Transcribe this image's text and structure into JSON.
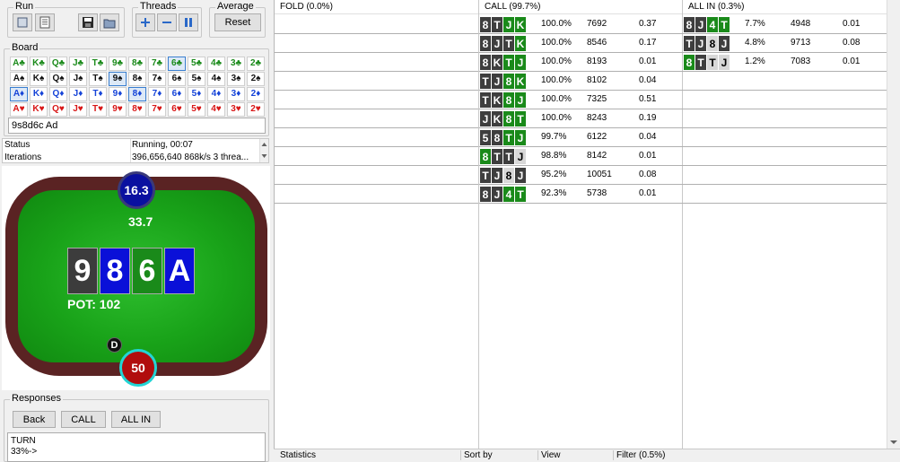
{
  "run": {
    "label": "Run"
  },
  "threads": {
    "label": "Threads"
  },
  "average": {
    "label": "Average",
    "reset_label": "Reset"
  },
  "board_group": {
    "label": "Board",
    "input_value": "9s8d6c Ad"
  },
  "card_grid": [
    {
      "suit": "c",
      "suit_symbol": "♣",
      "cards": [
        "A♣",
        "K♣",
        "Q♣",
        "J♣",
        "T♣",
        "9♣",
        "8♣",
        "7♣",
        "6♣",
        "5♣",
        "4♣",
        "3♣",
        "2♣"
      ],
      "selected_index": 8
    },
    {
      "suit": "s",
      "suit_symbol": "♠",
      "cards": [
        "A♠",
        "K♠",
        "Q♠",
        "J♠",
        "T♠",
        "9♠",
        "8♠",
        "7♠",
        "6♠",
        "5♠",
        "4♠",
        "3♠",
        "2♠"
      ],
      "selected_index": 5
    },
    {
      "suit": "d",
      "suit_symbol": "♦",
      "cards": [
        "A♦",
        "K♦",
        "Q♦",
        "J♦",
        "T♦",
        "9♦",
        "8♦",
        "7♦",
        "6♦",
        "5♦",
        "4♦",
        "3♦",
        "2♦"
      ],
      "selected_index": 6,
      "selected_index_2": 0
    },
    {
      "suit": "h",
      "suit_symbol": "♥",
      "cards": [
        "A♥",
        "K♥",
        "Q♥",
        "J♥",
        "T♥",
        "9♥",
        "8♥",
        "7♥",
        "6♥",
        "5♥",
        "4♥",
        "3♥",
        "2♥"
      ],
      "selected_index": -1
    }
  ],
  "status": {
    "status_label": "Status",
    "status_value": "Running, 00:07",
    "iterations_label": "Iterations",
    "iterations_value": "396,656,640  868k/s 3 threa..."
  },
  "table": {
    "top_stack": "16.3",
    "top_bet": "33.7",
    "bottom_stack": "50",
    "dealer": "D",
    "pot_label": "POT: 102",
    "board_cards": [
      {
        "rank": "9",
        "color": "#3c3c3c"
      },
      {
        "rank": "8",
        "color": "#0a10d8"
      },
      {
        "rank": "6",
        "color": "#1a8a1a"
      },
      {
        "rank": "A",
        "color": "#0a10d8"
      }
    ]
  },
  "responses": {
    "label": "Responses",
    "back_label": "Back",
    "call_label": "CALL",
    "allin_label": "ALL IN",
    "text_line1": "TURN",
    "text_line2": "33%->"
  },
  "columns": {
    "fold_header": "FOLD (0.0%)",
    "call_header": "CALL (99.7%)",
    "allin_header": "ALL IN (0.3%)"
  },
  "call_rows": [
    {
      "cards": [
        [
          "8",
          "k"
        ],
        [
          "T",
          "k"
        ],
        [
          "J",
          "g"
        ],
        [
          "K",
          "g"
        ]
      ],
      "pct": "100.0%",
      "count": "7692",
      "ev": "0.37"
    },
    {
      "cards": [
        [
          "8",
          "k"
        ],
        [
          "J",
          "k"
        ],
        [
          "T",
          "k"
        ],
        [
          "K",
          "g"
        ]
      ],
      "pct": "100.0%",
      "count": "8546",
      "ev": "0.17"
    },
    {
      "cards": [
        [
          "8",
          "k"
        ],
        [
          "K",
          "k"
        ],
        [
          "T",
          "g"
        ],
        [
          "J",
          "g"
        ]
      ],
      "pct": "100.0%",
      "count": "8193",
      "ev": "0.01"
    },
    {
      "cards": [
        [
          "T",
          "k"
        ],
        [
          "J",
          "k"
        ],
        [
          "8",
          "g"
        ],
        [
          "K",
          "g"
        ]
      ],
      "pct": "100.0%",
      "count": "8102",
      "ev": "0.04"
    },
    {
      "cards": [
        [
          "T",
          "k"
        ],
        [
          "K",
          "k"
        ],
        [
          "8",
          "g"
        ],
        [
          "J",
          "g"
        ]
      ],
      "pct": "100.0%",
      "count": "7325",
      "ev": "0.51"
    },
    {
      "cards": [
        [
          "J",
          "k"
        ],
        [
          "K",
          "k"
        ],
        [
          "8",
          "g"
        ],
        [
          "T",
          "g"
        ]
      ],
      "pct": "100.0%",
      "count": "8243",
      "ev": "0.19"
    },
    {
      "cards": [
        [
          "5",
          "k"
        ],
        [
          "8",
          "k"
        ],
        [
          "T",
          "g"
        ],
        [
          "J",
          "g"
        ]
      ],
      "pct": "99.7%",
      "count": "6122",
      "ev": "0.04"
    },
    {
      "cards": [
        [
          "8",
          "g"
        ],
        [
          "T",
          "k"
        ],
        [
          "T",
          "k"
        ],
        [
          "J",
          "w"
        ]
      ],
      "pct": "98.8%",
      "count": "8142",
      "ev": "0.01"
    },
    {
      "cards": [
        [
          "T",
          "k"
        ],
        [
          "J",
          "k"
        ],
        [
          "8",
          "w"
        ],
        [
          "J",
          "k"
        ]
      ],
      "pct": "95.2%",
      "count": "10051",
      "ev": "0.08"
    },
    {
      "cards": [
        [
          "8",
          "k"
        ],
        [
          "J",
          "k"
        ],
        [
          "4",
          "g"
        ],
        [
          "T",
          "g"
        ]
      ],
      "pct": "92.3%",
      "count": "5738",
      "ev": "0.01"
    }
  ],
  "allin_rows": [
    {
      "cards": [
        [
          "8",
          "k"
        ],
        [
          "J",
          "k"
        ],
        [
          "4",
          "g"
        ],
        [
          "T",
          "g"
        ]
      ],
      "pct": "7.7%",
      "count": "4948",
      "ev": "0.01"
    },
    {
      "cards": [
        [
          "T",
          "k"
        ],
        [
          "J",
          "k"
        ],
        [
          "8",
          "w"
        ],
        [
          "J",
          "k"
        ]
      ],
      "pct": "4.8%",
      "count": "9713",
      "ev": "0.08"
    },
    {
      "cards": [
        [
          "8",
          "g"
        ],
        [
          "T",
          "k"
        ],
        [
          "T",
          "w"
        ],
        [
          "J",
          "w"
        ]
      ],
      "pct": "1.2%",
      "count": "7083",
      "ev": "0.01"
    }
  ],
  "bottom_tabs": {
    "statistics": "Statistics",
    "sort_by": "Sort by",
    "view": "View",
    "filter": "Filter (0.5%)"
  }
}
